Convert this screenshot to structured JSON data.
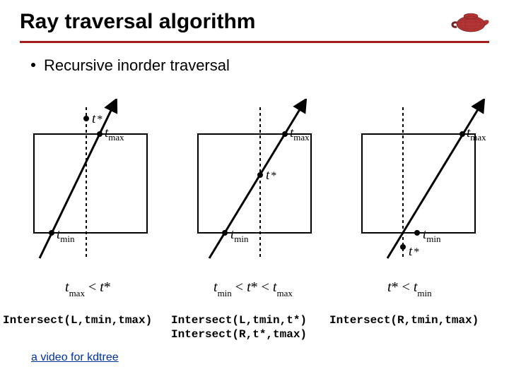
{
  "title": "Ray traversal algorithm",
  "bullet": "Recursive inorder traversal",
  "link": "a video for kdtree",
  "labels": {
    "t": "t",
    "tstar": "t *",
    "tmax": "t",
    "tmax_sub": "max",
    "tmin": "t",
    "tmin_sub": "min",
    "star": "*"
  },
  "conditions": {
    "c1_html": "<i>t</i><span class='sub'>max</span> &lt; <i>t</i>*",
    "c2_html": "<i>t</i><span class='sub'>min</span> &lt; <i>t</i>* &lt; <i>t</i><span class='sub'>max</span>",
    "c3_html": "<i>t</i>* &lt; <i>t</i><span class='sub'>min</span>"
  },
  "calls": {
    "c1": "Intersect(L,tmin,tmax)",
    "c2": "Intersect(L,tmin,t*)\nIntersect(R,t*,tmax)",
    "c3": "Intersect(R,tmin,tmax)"
  }
}
